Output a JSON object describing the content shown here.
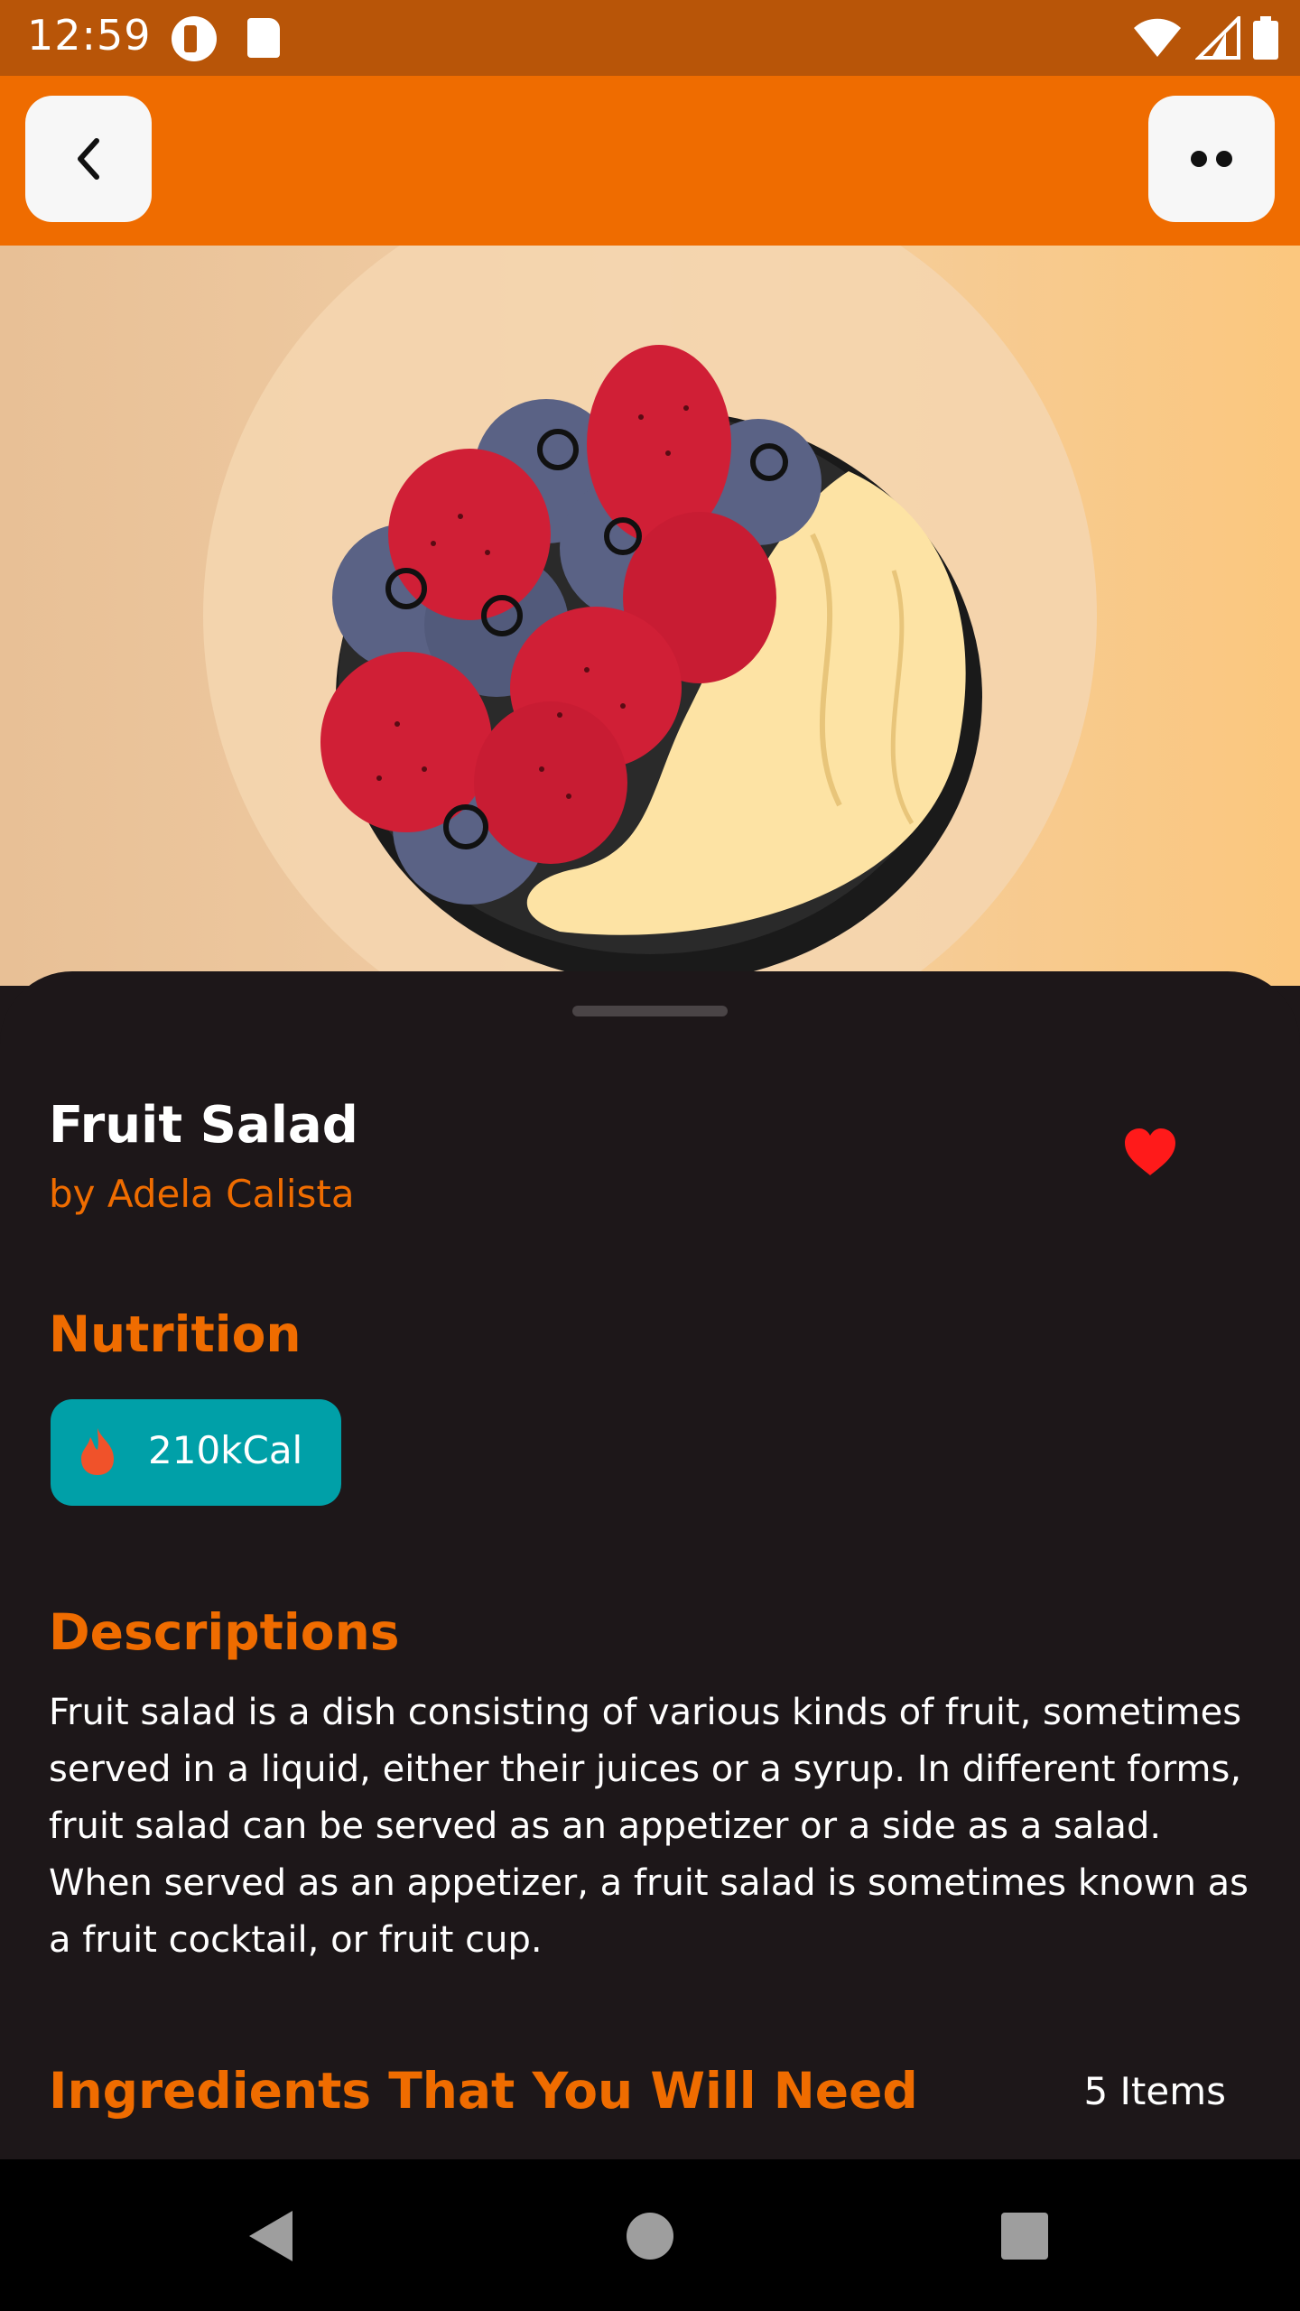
{
  "status_bar": {
    "time": "12:59",
    "icons": [
      "app-notification-icon",
      "sd-card-icon",
      "wifi-icon",
      "signal-icon",
      "battery-icon"
    ]
  },
  "app_bar": {
    "back_icon": "chevron-left-icon",
    "more_icon": "more-dots-icon"
  },
  "hero": {
    "image": "fruit-salad-bowl-illustration"
  },
  "recipe": {
    "title": "Fruit Salad",
    "author": "by Adela Calista",
    "favorite": true
  },
  "nutrition": {
    "heading": "Nutrition",
    "calories": "210kCal"
  },
  "descriptions": {
    "heading": "Descriptions",
    "text": "Fruit salad is a dish consisting of various kinds of fruit, sometimes served in a liquid, either their juices or a syrup. In different forms, fruit salad can be served as an appetizer or a side as a salad. When served as an appetizer, a fruit salad is sometimes known as a fruit cocktail, or fruit cup."
  },
  "ingredients": {
    "heading": "Ingredients That You Will Need",
    "count": "5 Items"
  },
  "colors": {
    "accent": "#ef6c00",
    "status_bar": "#b85508",
    "chip": "#00a0a8",
    "sheet": "#1d1719",
    "heart": "#ff1a1a"
  },
  "nav_bar": {
    "icons": [
      "nav-back-icon",
      "nav-home-icon",
      "nav-recents-icon"
    ]
  }
}
